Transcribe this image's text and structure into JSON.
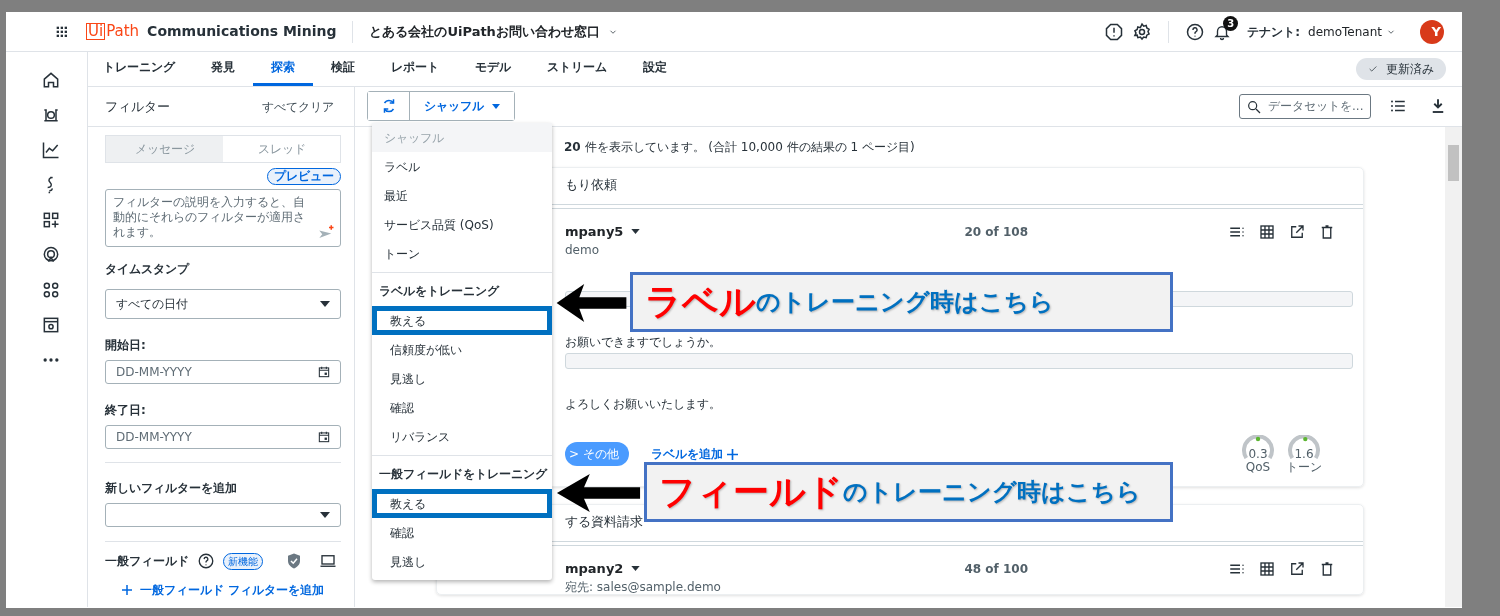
{
  "top_bar": {
    "logo_box": "Ui",
    "logo_text": "Path",
    "product": "Communications Mining",
    "workspace": "とある会社のUiPathお問い合わせ窓口",
    "notification_count": "3",
    "tenant_label": "テナント:",
    "tenant": "demoTenant",
    "avatar_initial": "Y"
  },
  "tabs": [
    {
      "label": "トレーニング",
      "selected": false
    },
    {
      "label": "発見",
      "selected": false
    },
    {
      "label": "探索",
      "selected": true
    },
    {
      "label": "検証",
      "selected": false
    },
    {
      "label": "レポート",
      "selected": false
    },
    {
      "label": "モデル",
      "selected": false
    },
    {
      "label": "ストリーム",
      "selected": false
    },
    {
      "label": "設定",
      "selected": false
    }
  ],
  "status_pill": "更新済み",
  "filter_panel": {
    "title": "フィルター",
    "clear": "すべてクリア",
    "modes": [
      {
        "label": "メッセージ",
        "selected": true
      },
      {
        "label": "スレッド",
        "selected": false
      }
    ],
    "preview_badge": "プレビュー",
    "description_placeholder": "フィルターの説明を入力すると、自動的にそれらのフィルターが適用されます。",
    "timestamp_label": "タイムスタンプ",
    "timestamp_value": "すべての日付",
    "start_label": "開始日:",
    "start_placeholder": "DD-MM-YYYY",
    "end_label": "終了日:",
    "end_placeholder": "DD-MM-YYYY",
    "new_filter_label": "新しいフィルターを追加",
    "general_fields_label": "一般フィールド",
    "new_badge": "新機能",
    "add_general_filter": "一般フィールド フィルターを追加"
  },
  "toolbar": {
    "sort_button": "シャッフル",
    "search_placeholder": "データセットを..."
  },
  "sort_menu": {
    "sections": [
      {
        "items": [
          {
            "label": "シャッフル",
            "selected": true,
            "highlighted": false
          },
          {
            "label": "ラベル",
            "selected": false,
            "highlighted": false
          },
          {
            "label": "最近",
            "selected": false,
            "highlighted": false
          },
          {
            "label": "サービス品質 (QoS)",
            "selected": false,
            "highlighted": false
          },
          {
            "label": "トーン",
            "selected": false,
            "highlighted": false
          }
        ]
      },
      {
        "heading": "ラベルをトレーニング",
        "items": [
          {
            "label": "教える",
            "selected": false,
            "highlighted": true
          },
          {
            "label": "信頼度が低い",
            "selected": false,
            "highlighted": false
          },
          {
            "label": "見逃し",
            "selected": false,
            "highlighted": false
          },
          {
            "label": "確認",
            "selected": false,
            "highlighted": false
          },
          {
            "label": "リバランス",
            "selected": false,
            "highlighted": false
          }
        ]
      },
      {
        "heading": "一般フィールドをトレーニング",
        "items": [
          {
            "label": "教える",
            "selected": false,
            "highlighted": true
          },
          {
            "label": "確認",
            "selected": false,
            "highlighted": false
          },
          {
            "label": "見逃し",
            "selected": false,
            "highlighted": false
          }
        ]
      }
    ]
  },
  "results_summary": "**20** 件を表示しています。 (合計 10,000 件の結果の 1 ページ目)",
  "messages": [
    {
      "subject": "もり依頼",
      "sender": "mpany5",
      "position": "20 of 108",
      "recipient": "demo",
      "body": [
        {
          "kind": "bar"
        },
        {
          "kind": "text",
          "text": "お願いできますでしょうか。"
        },
        {
          "kind": "bar"
        },
        {
          "kind": "text",
          "text": "よろしくお願いいたします。"
        }
      ],
      "labels": [
        "> その他"
      ],
      "add_label": "ラベルを追加",
      "gauges": [
        {
          "value": "0.3",
          "name": "QoS",
          "level": 0.5
        },
        {
          "value": "1.6",
          "name": "トーン",
          "level": 0.52
        }
      ]
    },
    {
      "subject": "する資料請求",
      "sender": "mpany2",
      "position": "48 of 100",
      "recipient": "宛先: sales@sample.demo"
    }
  ],
  "callouts": [
    {
      "emphasis": "ラベル",
      "text": "のトレーニング時はこちら"
    },
    {
      "emphasis": "フィールド",
      "text": "のトレーニング時はこちら"
    }
  ]
}
